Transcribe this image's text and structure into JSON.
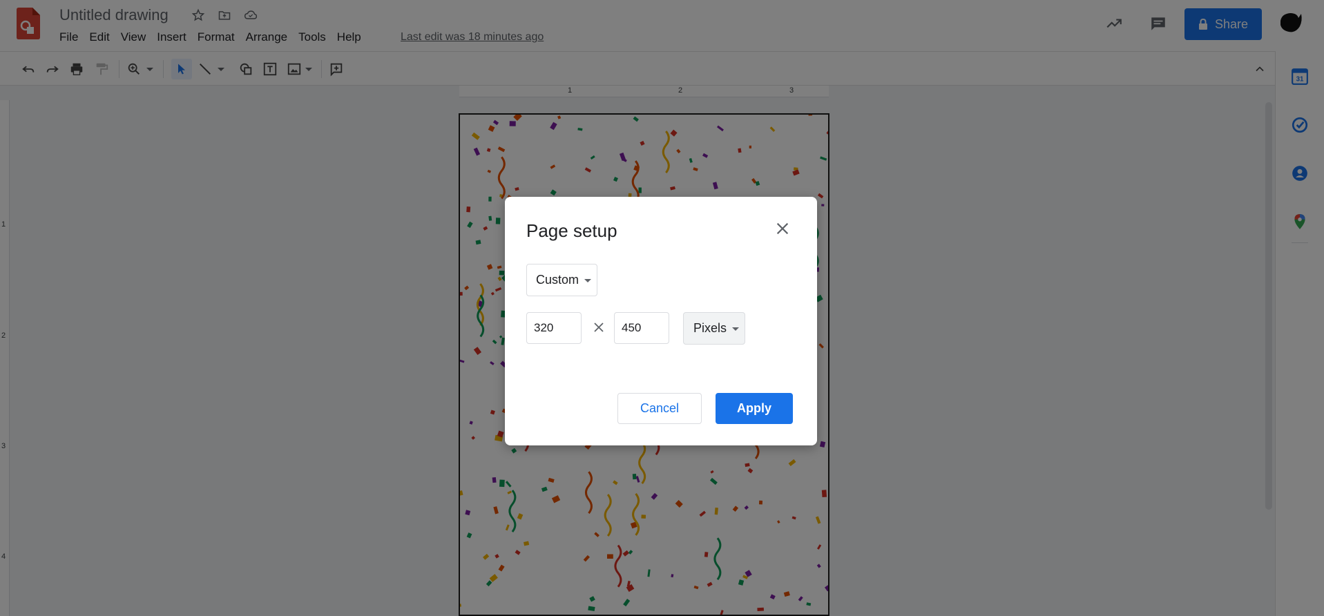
{
  "header": {
    "doc_title": "Untitled drawing",
    "last_edit": "Last edit was 18 minutes ago",
    "share_label": "Share"
  },
  "menu": [
    {
      "label": "File"
    },
    {
      "label": "Edit"
    },
    {
      "label": "View"
    },
    {
      "label": "Insert"
    },
    {
      "label": "Format"
    },
    {
      "label": "Arrange"
    },
    {
      "label": "Tools"
    },
    {
      "label": "Help"
    }
  ],
  "ruler": {
    "h_ticks": [
      "1",
      "2",
      "3"
    ],
    "v_ticks": [
      "1",
      "2",
      "3",
      "4"
    ]
  },
  "dialog": {
    "title": "Page setup",
    "preset": "Custom",
    "width_value": "320",
    "height_value": "450",
    "unit": "Pixels",
    "cancel_label": "Cancel",
    "apply_label": "Apply"
  },
  "colors": {
    "accent": "#1a73e8",
    "drawings_brand": "#db4437"
  }
}
